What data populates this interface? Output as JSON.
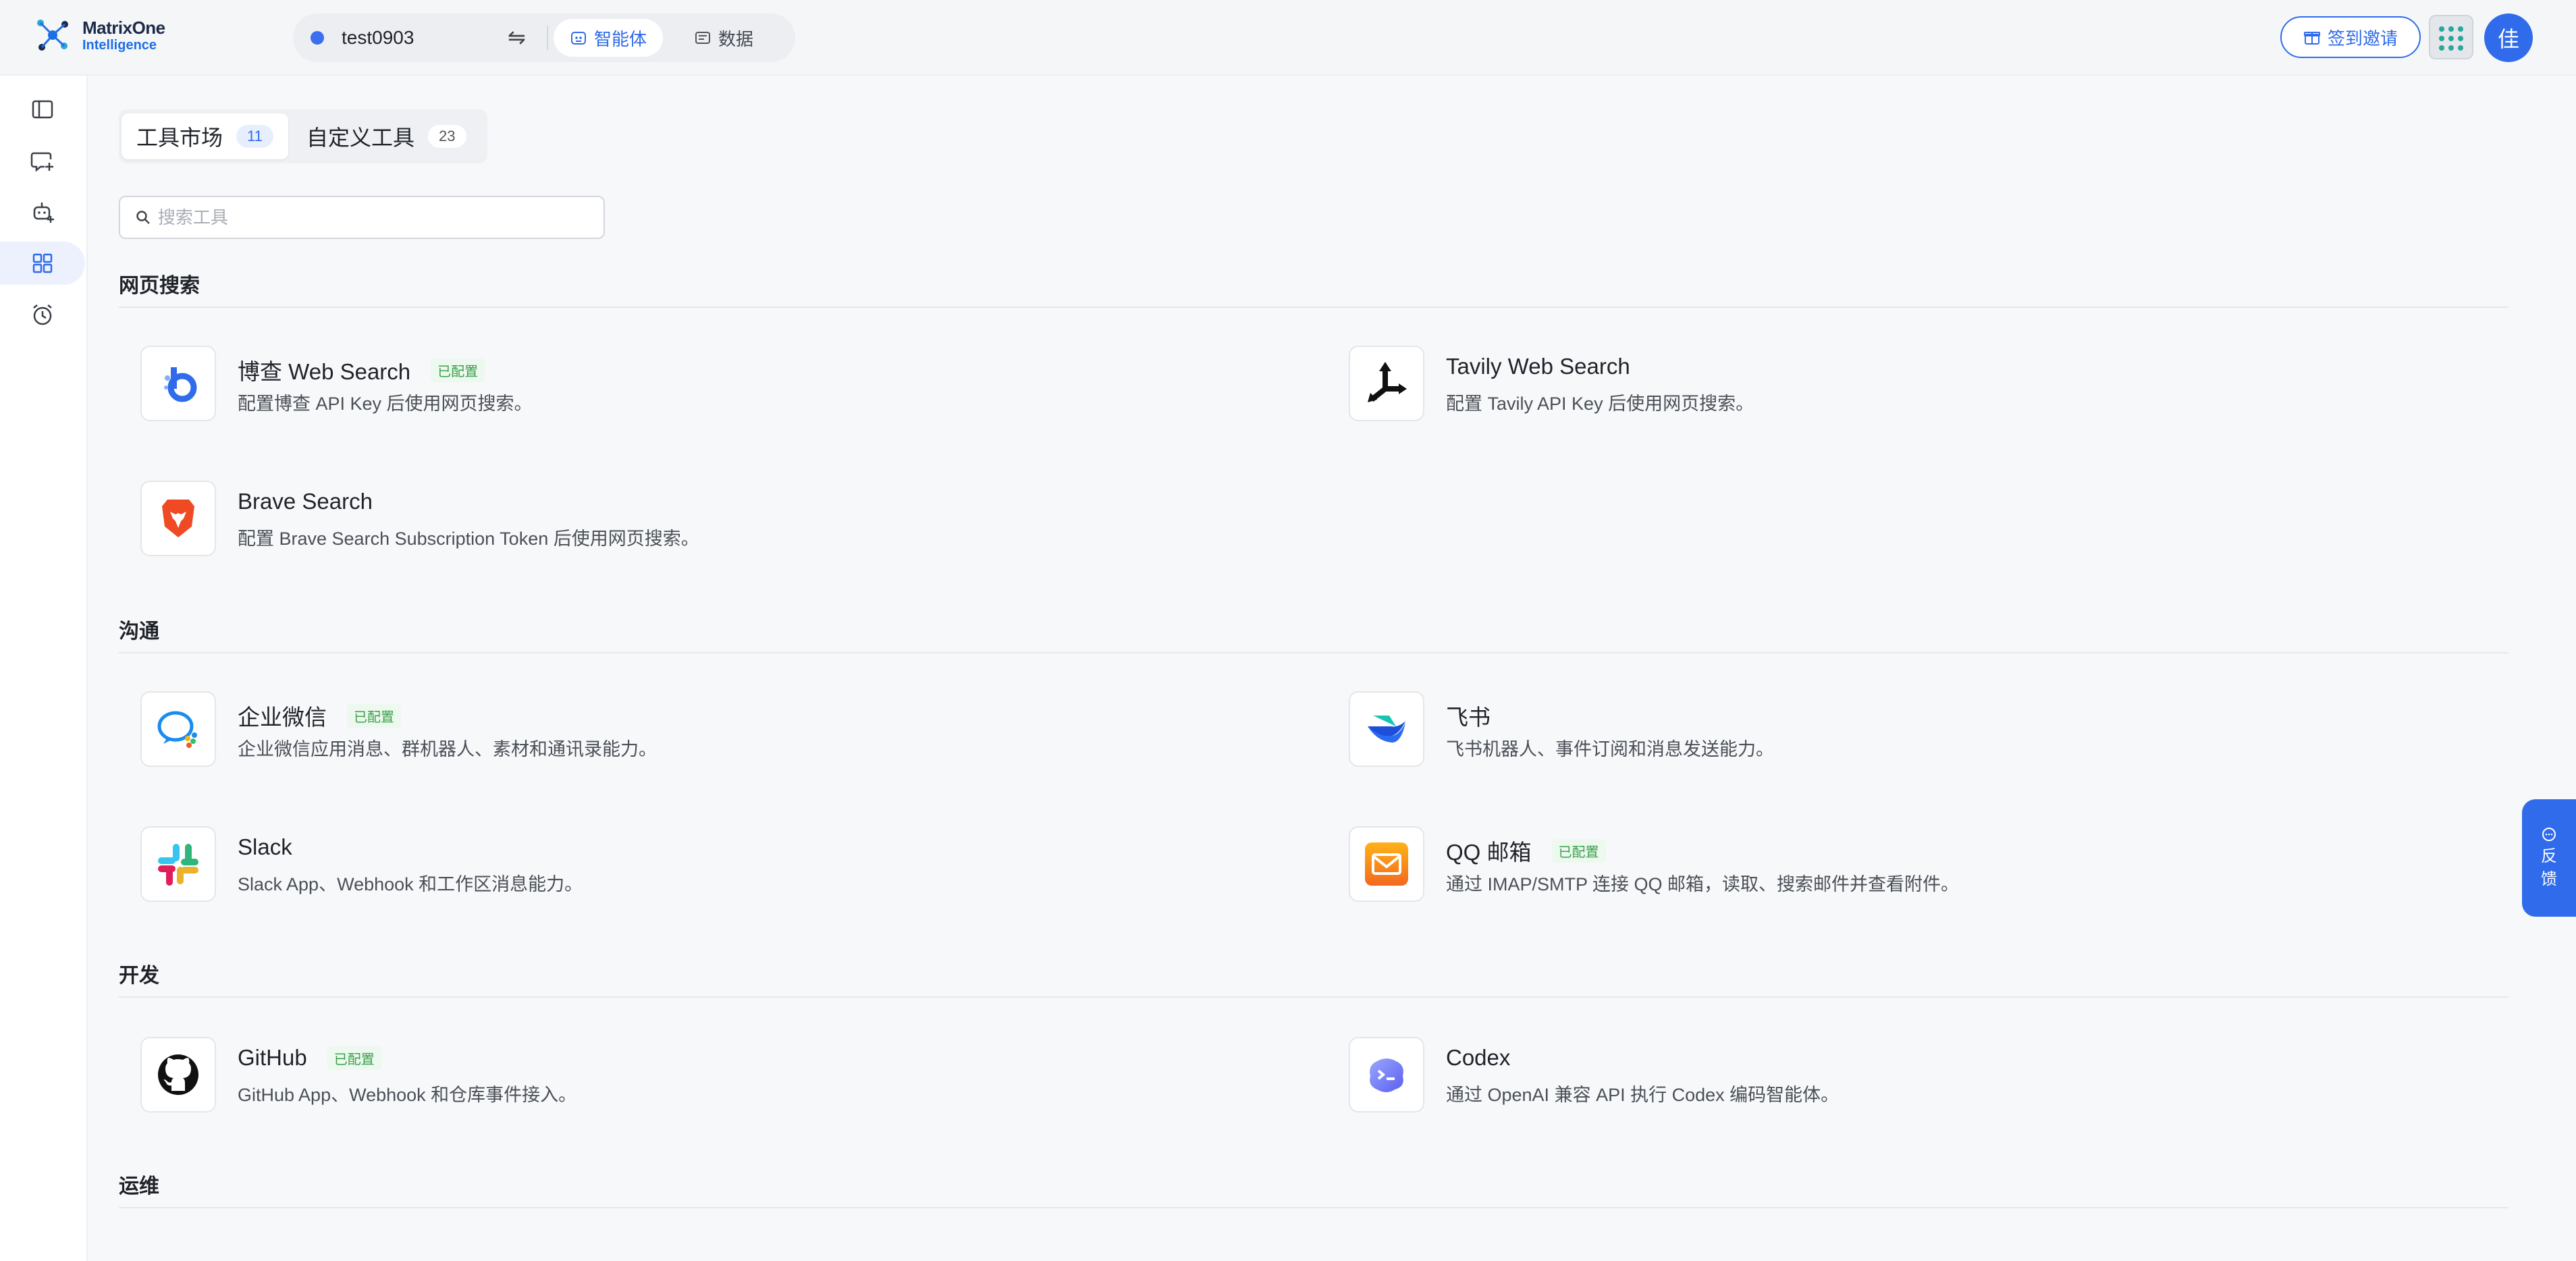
{
  "header": {
    "logo_line1": "MatrixOne",
    "logo_line2": "Intelligence",
    "workspace_name": "test0903",
    "swap_glyph": "⇋",
    "tabs": [
      {
        "label": "智能体",
        "icon": "robot-icon",
        "active": true
      },
      {
        "label": "数据",
        "icon": "database-icon",
        "active": false
      }
    ],
    "invite_label": "签到邀请",
    "invite_icon": "🎁",
    "avatar_text": "佳",
    "accent_color": "#2f6bea"
  },
  "sidebar": {
    "items": [
      {
        "name": "sidebar-toggle",
        "icon": "panel-icon"
      },
      {
        "name": "new-chat",
        "icon": "chat-plus-icon"
      },
      {
        "name": "agents",
        "icon": "bot-plus-icon"
      },
      {
        "name": "tools",
        "icon": "grid-icon",
        "active": true
      },
      {
        "name": "schedules",
        "icon": "alarm-clock-icon"
      }
    ]
  },
  "main": {
    "tabs": [
      {
        "label": "工具市场",
        "count": "11",
        "active": true
      },
      {
        "label": "自定义工具",
        "count": "23",
        "active": false
      }
    ],
    "search_placeholder": "搜索工具",
    "configured_label": "已配置",
    "sections": [
      {
        "title": "网页搜索",
        "tools": [
          {
            "name": "博查 Web Search",
            "desc": "配置博查 API Key 后使用网页搜索。",
            "configured": true,
            "icon": "bocha-icon"
          },
          {
            "name": "Tavily Web Search",
            "desc": "配置 Tavily API Key 后使用网页搜索。",
            "configured": false,
            "icon": "tavily-icon"
          },
          {
            "name": "Brave Search",
            "desc": "配置 Brave Search Subscription Token 后使用网页搜索。",
            "configured": false,
            "icon": "brave-icon"
          }
        ]
      },
      {
        "title": "沟通",
        "tools": [
          {
            "name": "企业微信",
            "desc": "企业微信应用消息、群机器人、素材和通讯录能力。",
            "configured": true,
            "icon": "wecom-icon"
          },
          {
            "name": "飞书",
            "desc": "飞书机器人、事件订阅和消息发送能力。",
            "configured": false,
            "icon": "feishu-icon"
          },
          {
            "name": "Slack",
            "desc": "Slack App、Webhook 和工作区消息能力。",
            "configured": false,
            "icon": "slack-icon"
          },
          {
            "name": "QQ 邮箱",
            "desc": "通过 IMAP/SMTP 连接 QQ 邮箱，读取、搜索邮件并查看附件。",
            "configured": true,
            "icon": "qq-mail-icon"
          }
        ]
      },
      {
        "title": "开发",
        "tools": [
          {
            "name": "GitHub",
            "desc": "GitHub App、Webhook 和仓库事件接入。",
            "configured": true,
            "icon": "github-icon"
          },
          {
            "name": "Codex",
            "desc": "通过 OpenAI 兼容 API 执行 Codex 编码智能体。",
            "configured": false,
            "icon": "codex-icon"
          }
        ]
      },
      {
        "title": "运维",
        "tools": []
      }
    ]
  },
  "feedback": {
    "label_line1": "反",
    "label_line2": "馈"
  }
}
